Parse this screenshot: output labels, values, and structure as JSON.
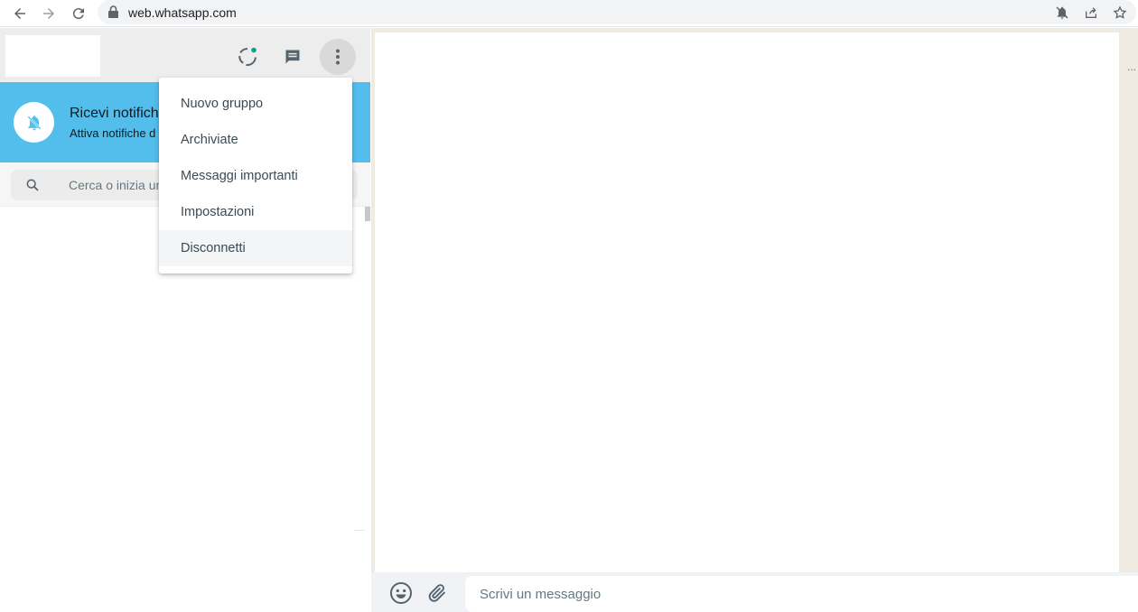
{
  "browser": {
    "url": "web.whatsapp.com",
    "icons": [
      "back-arrow-icon",
      "forward-arrow-icon",
      "reload-icon",
      "lock-icon",
      "muted-bell-icon",
      "share-icon",
      "star-icon"
    ]
  },
  "header": {
    "icons": [
      "status-icon",
      "new-chat-icon",
      "menu-dots-icon"
    ],
    "status_dot_color": "#00a884"
  },
  "notification": {
    "title": "Ricevi notifich",
    "subtitle": "Attiva notifiche d",
    "background": "#53bdeb"
  },
  "search": {
    "placeholder": "Cerca o inizia un"
  },
  "menu": {
    "items": [
      {
        "label": "Nuovo gruppo"
      },
      {
        "label": "Archiviate"
      },
      {
        "label": "Messaggi importanti"
      },
      {
        "label": "Impostazioni"
      },
      {
        "label": "Disconnetti"
      }
    ],
    "highlighted": "Disconnetti"
  },
  "conversation": {
    "header_more": "...",
    "compose_placeholder": "Scrivi un messaggio",
    "icons": [
      "emoji-icon",
      "attach-icon"
    ]
  }
}
